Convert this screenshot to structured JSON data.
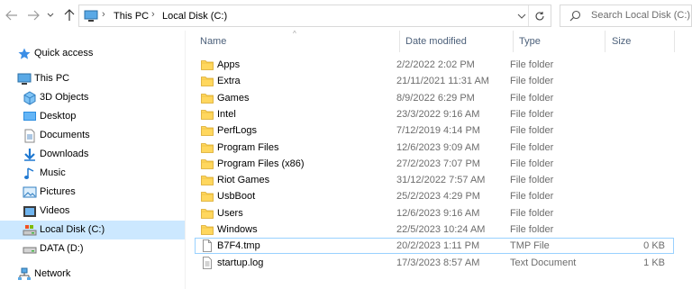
{
  "address_bar": {
    "crumbs": [
      "This PC",
      "Local Disk (C:)"
    ]
  },
  "search": {
    "placeholder": "Search Local Disk (C:)"
  },
  "navigation_pane": {
    "items": [
      {
        "label": "Quick access",
        "icon": "star-icon"
      },
      {
        "label": "This PC",
        "icon": "computer-icon"
      },
      {
        "label": "3D Objects",
        "icon": "3d-objects-icon"
      },
      {
        "label": "Desktop",
        "icon": "desktop-icon"
      },
      {
        "label": "Documents",
        "icon": "documents-icon"
      },
      {
        "label": "Downloads",
        "icon": "downloads-icon"
      },
      {
        "label": "Music",
        "icon": "music-icon"
      },
      {
        "label": "Pictures",
        "icon": "pictures-icon"
      },
      {
        "label": "Videos",
        "icon": "videos-icon"
      },
      {
        "label": "Local Disk (C:)",
        "icon": "drive-icon",
        "selected": true
      },
      {
        "label": "DATA (D:)",
        "icon": "drive-icon"
      },
      {
        "label": "Network",
        "icon": "network-icon"
      }
    ]
  },
  "columns": {
    "name": "Name",
    "date_modified": "Date modified",
    "type": "Type",
    "size": "Size"
  },
  "files": [
    {
      "name": "Apps",
      "date": "2/2/2022 2:02 PM",
      "type": "File folder",
      "size": "",
      "icon": "folder-icon"
    },
    {
      "name": "Extra",
      "date": "21/11/2021 11:31 AM",
      "type": "File folder",
      "size": "",
      "icon": "folder-icon"
    },
    {
      "name": "Games",
      "date": "8/9/2022 6:29 PM",
      "type": "File folder",
      "size": "",
      "icon": "folder-icon"
    },
    {
      "name": "Intel",
      "date": "23/3/2022 9:16 AM",
      "type": "File folder",
      "size": "",
      "icon": "folder-icon"
    },
    {
      "name": "PerfLogs",
      "date": "7/12/2019 4:14 PM",
      "type": "File folder",
      "size": "",
      "icon": "folder-icon"
    },
    {
      "name": "Program Files",
      "date": "12/6/2023 9:09 AM",
      "type": "File folder",
      "size": "",
      "icon": "folder-icon"
    },
    {
      "name": "Program Files (x86)",
      "date": "27/2/2023 7:07 PM",
      "type": "File folder",
      "size": "",
      "icon": "folder-icon"
    },
    {
      "name": "Riot Games",
      "date": "31/12/2022 7:57 AM",
      "type": "File folder",
      "size": "",
      "icon": "folder-icon"
    },
    {
      "name": "UsbBoot",
      "date": "25/2/2023 4:29 PM",
      "type": "File folder",
      "size": "",
      "icon": "folder-icon"
    },
    {
      "name": "Users",
      "date": "12/6/2023 9:16 AM",
      "type": "File folder",
      "size": "",
      "icon": "folder-icon"
    },
    {
      "name": "Windows",
      "date": "22/5/2023 10:24 AM",
      "type": "File folder",
      "size": "",
      "icon": "folder-icon"
    },
    {
      "name": "B7F4.tmp",
      "date": "20/2/2023 1:11 PM",
      "type": "TMP File",
      "size": "0 KB",
      "icon": "file-icon"
    },
    {
      "name": "startup.log",
      "date": "17/3/2023 8:57 AM",
      "type": "Text Document",
      "size": "1 KB",
      "icon": "text-file-icon"
    }
  ],
  "colors": {
    "selection": "#cce8ff",
    "folder": "#ffd75e",
    "column_header_text": "#4c607a",
    "secondary_text": "#6d6d6d"
  }
}
